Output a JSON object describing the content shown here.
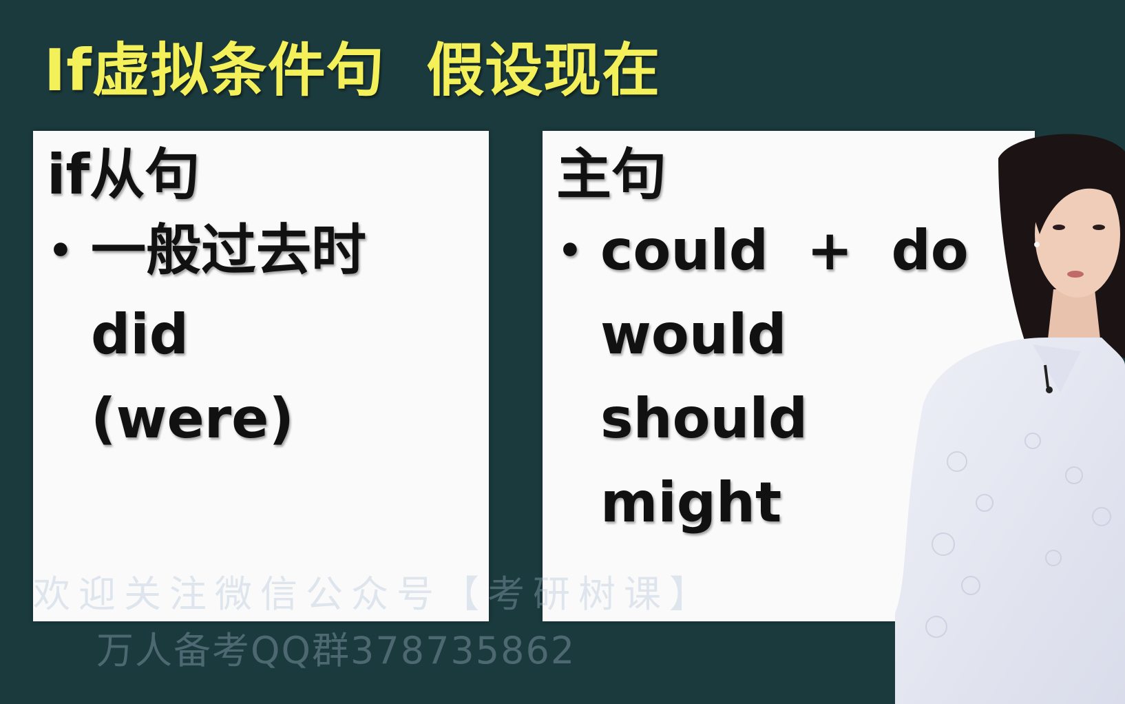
{
  "slide": {
    "title": "If虚拟条件句  假设现在"
  },
  "left_panel": {
    "heading": "if从句",
    "bullet": "•",
    "lines": [
      "一般过去时",
      "did",
      "(were)"
    ]
  },
  "right_panel": {
    "heading": "主句",
    "bullet": "•",
    "lines": [
      "could  +  do",
      "would",
      "should",
      "might"
    ]
  },
  "watermarks": {
    "line1": "欢迎关注微信公众号【考研树课】",
    "line2": "万人备考QQ群378735862"
  },
  "colors": {
    "background": "#1b3a3d",
    "title": "#f4f05a",
    "panel": "#fafafa",
    "text": "#111111"
  }
}
